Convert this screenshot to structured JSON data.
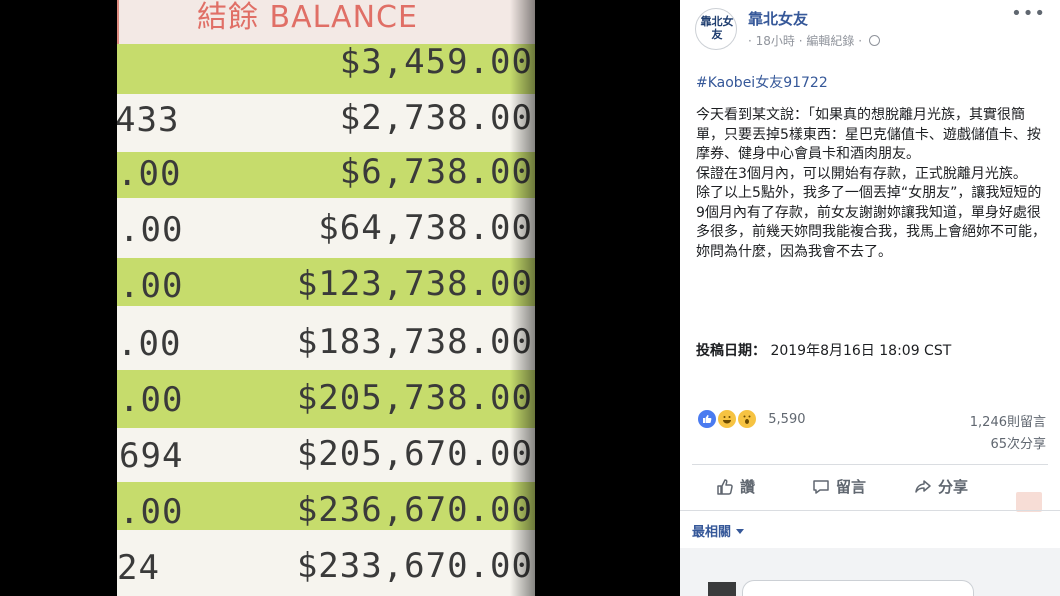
{
  "photo": {
    "header_label": "結餘 BALANCE",
    "rows": [
      {
        "left": "",
        "amount": "$3,459.00"
      },
      {
        "left": "433",
        "amount": "$2,738.00"
      },
      {
        "left": ".00",
        "amount": "$6,738.00"
      },
      {
        "left": ".00",
        "amount": "$64,738.00"
      },
      {
        "left": ".00",
        "amount": "$123,738.00"
      },
      {
        "left": ".00",
        "amount": "$183,738.00"
      },
      {
        "left": ".00",
        "amount": "$205,738.00"
      },
      {
        "left": "694",
        "amount": "$205,670.00"
      },
      {
        "left": ".00",
        "amount": "$236,670.00"
      },
      {
        "left": "24",
        "amount": "$233,670.00"
      }
    ]
  },
  "post": {
    "page_name": "靠北女友",
    "avatar_text": "靠北女友",
    "time": "18小時",
    "edit_history": "編輯紀錄",
    "meta_sep": "·",
    "more": "•••",
    "hashtag": "#Kaobei女友91722",
    "body": [
      "今天看到某文說：「如果真的想脫離月光族，其實很簡單，只要丟掉5樣東西：星巴克儲值卡、遊戲儲值卡、按摩券、健身中心會員卡和酒肉朋友。",
      "保證在3個月內，可以開始有存款，正式脫離月光族。",
      "除了以上5點外，我多了一個丟掉“女朋友”，讓我短短的9個月內有了存款，前女友謝謝妳讓我知道，單身好處很多很多，前幾天妳問我能複合我，我馬上會絕妳不可能，妳問為什麼，因為我會不去了。"
    ],
    "date_label": "投稿日期：",
    "date_value": "2019年8月16日 18:09 CST",
    "reaction_count": "5,590",
    "comments_count": "1,246則留言",
    "shares_count": "65次分享",
    "actions": {
      "like": "讚",
      "comment": "留言",
      "share": "分享"
    },
    "sort_label": "最相關"
  },
  "colors": {
    "band_green": "#c6dc6c",
    "link_blue": "#365899",
    "like_blue": "#4a7bf0",
    "header_red": "#e06f66"
  }
}
